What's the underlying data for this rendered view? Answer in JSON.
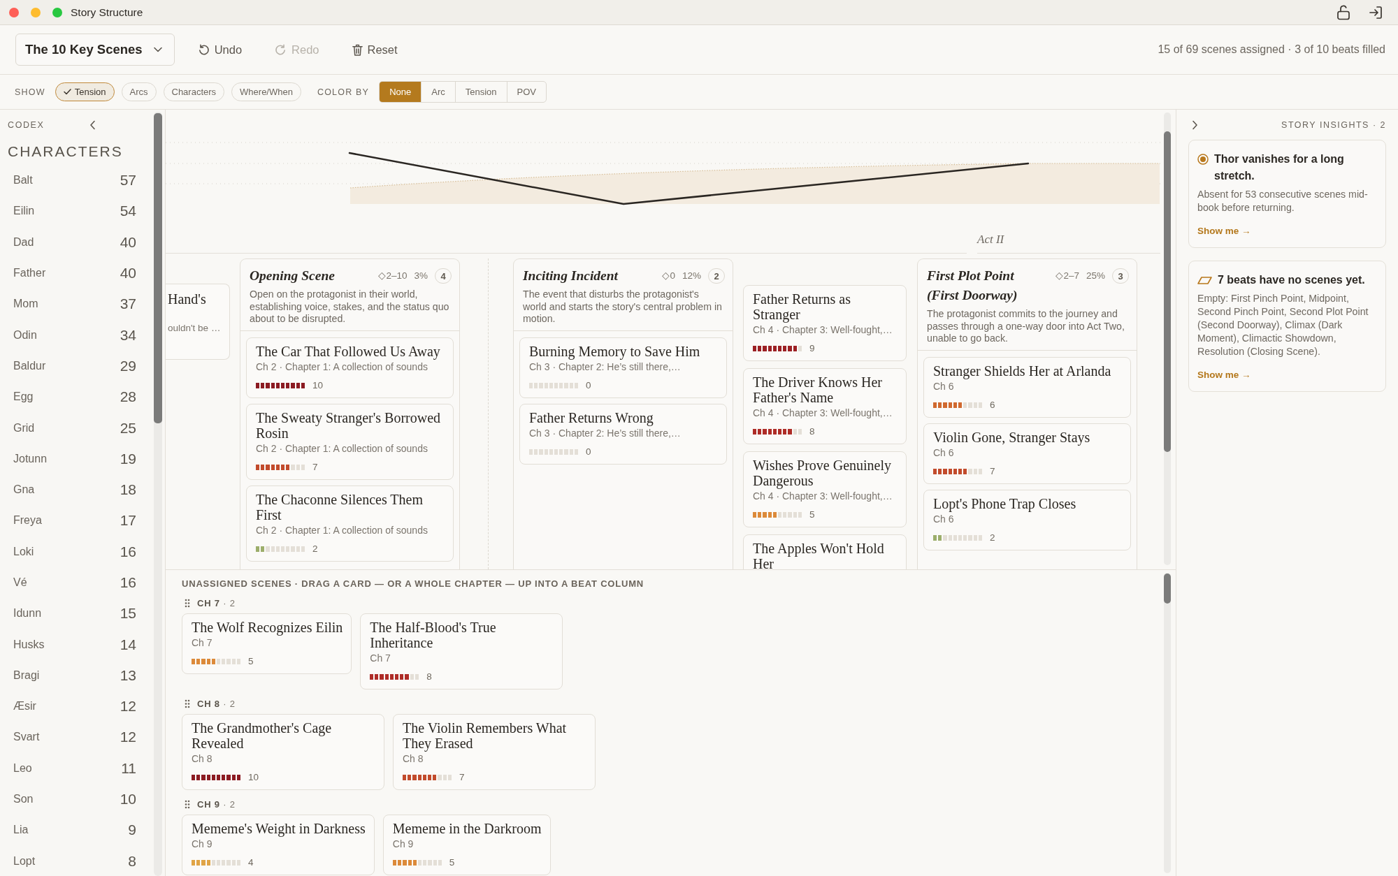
{
  "window": {
    "title": "Story Structure"
  },
  "toolbar": {
    "structure_picker": "The 10 Key Scenes",
    "actions": [
      {
        "kind": "undo",
        "label": "Undo",
        "disabled": false
      },
      {
        "kind": "redo",
        "label": "Redo",
        "disabled": true
      },
      {
        "kind": "reset",
        "label": "Reset",
        "disabled": false
      }
    ],
    "status": "15 of 69 scenes assigned · 3 of 10 beats filled"
  },
  "filter_bar": {
    "show_label": "SHOW",
    "show_toggles": [
      {
        "label": "Tension",
        "on": true
      },
      {
        "label": "Arcs",
        "on": false
      },
      {
        "label": "Characters",
        "on": false
      },
      {
        "label": "Where/When",
        "on": false
      }
    ],
    "color_by_label": "COLOR BY",
    "color_by_options": [
      {
        "label": "None",
        "selected": true
      },
      {
        "label": "Arc",
        "selected": false
      },
      {
        "label": "Tension",
        "selected": false
      },
      {
        "label": "POV",
        "selected": false
      }
    ]
  },
  "codex": {
    "title": "CODEX",
    "section": "CHARACTERS",
    "characters": [
      {
        "name": "Balt",
        "count": "57"
      },
      {
        "name": "Eilin",
        "count": "54"
      },
      {
        "name": "Dad",
        "count": "40"
      },
      {
        "name": "Father",
        "count": "40"
      },
      {
        "name": "Mom",
        "count": "37"
      },
      {
        "name": "Odin",
        "count": "34"
      },
      {
        "name": "Baldur",
        "count": "29"
      },
      {
        "name": "Egg",
        "count": "28"
      },
      {
        "name": "Grid",
        "count": "25"
      },
      {
        "name": "Jotunn",
        "count": "19"
      },
      {
        "name": "Gna",
        "count": "18"
      },
      {
        "name": "Freya",
        "count": "17"
      },
      {
        "name": "Loki",
        "count": "16"
      },
      {
        "name": "Vé",
        "count": "16"
      },
      {
        "name": "Idunn",
        "count": "15"
      },
      {
        "name": "Husks",
        "count": "14"
      },
      {
        "name": "Bragi",
        "count": "13"
      },
      {
        "name": "Æsir",
        "count": "12"
      },
      {
        "name": "Svart",
        "count": "12"
      },
      {
        "name": "Leo",
        "count": "11"
      },
      {
        "name": "Son",
        "count": "10"
      },
      {
        "name": "Lia",
        "count": "9"
      },
      {
        "name": "Lopt",
        "count": "8"
      }
    ]
  },
  "board": {
    "act_label": "Act II",
    "columns": [
      {
        "kind": "clipped",
        "scenes": [
          {
            "title": "Hand's",
            "subtitle": "ouldn't be …"
          }
        ]
      },
      {
        "kind": "beat",
        "title": "Opening Scene",
        "range": "◇2–10",
        "share": "3%",
        "count": "4",
        "description": "Open on the protagonist in their world, establishing voice, stakes, and the status quo about to be disrupted.",
        "scenes": [
          {
            "title": "The Car That Followed Us Away",
            "subtitle": "Ch 2 · Chapter 1: A collection of sounds",
            "level": 1.0,
            "reading": "10"
          },
          {
            "title": "The Sweaty Stranger's Borrowed Rosin",
            "subtitle": "Ch 2 · Chapter 1: A collection of sounds",
            "level": 0.7,
            "reading": "7"
          },
          {
            "title": "The Chaconne Silences Them First",
            "subtitle": "Ch 2 · Chapter 1: A collection of sounds",
            "level": 0.2,
            "reading": "2"
          }
        ]
      },
      {
        "kind": "divider"
      },
      {
        "kind": "beat",
        "title": "Inciting Incident",
        "range": "◇0",
        "share": "12%",
        "count": "2",
        "description": "The event that disturbs the protagonist's world and starts the story's central problem in motion.",
        "scenes": [
          {
            "title": "Burning Memory to Save Him",
            "subtitle": "Ch 3 · Chapter 2: He’s still there,…",
            "level": 0,
            "reading": "0"
          },
          {
            "title": "Father Returns Wrong",
            "subtitle": "Ch 3 · Chapter 2: He’s still there,…",
            "level": 0,
            "reading": "0"
          }
        ]
      },
      {
        "kind": "loose",
        "scenes": [
          {
            "title": "Father Returns as Stranger",
            "subtitle": "Ch 4 · Chapter 3: Well-fought,…",
            "level": 0.9,
            "reading": "9"
          },
          {
            "title": "The Driver Knows Her Father's Name",
            "subtitle": "Ch 4 · Chapter 3: Well-fought,…",
            "level": 0.8,
            "reading": "8"
          },
          {
            "title": "Wishes Prove Genuinely Dangerous",
            "subtitle": "Ch 4 · Chapter 3: Well-fought,…",
            "level": 0.5,
            "reading": "5"
          },
          {
            "title": "The Apples Won't Hold Her"
          }
        ]
      },
      {
        "kind": "beat",
        "title": "First Plot Point (First Doorway)",
        "range": "◇2–7",
        "share": "25%",
        "count": "3",
        "description": "The protagonist commits to the journey and passes through a one-way door into Act Two, unable to go back.",
        "scenes": [
          {
            "title": "Stranger Shields Her at Arlanda",
            "subtitle": "Ch 6",
            "level": 0.6,
            "reading": "6"
          },
          {
            "title": "Violin Gone, Stranger Stays",
            "subtitle": "Ch 6",
            "level": 0.7,
            "reading": "7"
          },
          {
            "title": "Lopt's Phone Trap Closes",
            "subtitle": "Ch 6",
            "level": 0.2,
            "reading": "2"
          }
        ]
      }
    ]
  },
  "unassigned": {
    "title": "UNASSIGNED SCENES · DRAG A CARD — OR A WHOLE CHAPTER — UP INTO A BEAT COLUMN",
    "chapters": [
      {
        "label": "**CH 7** · 2",
        "scenes": [
          {
            "title": "The Wolf Recognizes Eilin",
            "subtitle": "Ch 7",
            "level": 0.5,
            "reading": "5"
          },
          {
            "title": "The Half-Blood's True Inheritance",
            "subtitle": "Ch 7",
            "level": 0.8,
            "reading": "8"
          }
        ]
      },
      {
        "label": "**CH 8** · 2",
        "scenes": [
          {
            "title": "The Grandmother's Cage Revealed",
            "subtitle": "Ch 8",
            "level": 1.0,
            "reading": "10"
          },
          {
            "title": "The Violin Remembers What They Erased",
            "subtitle": "Ch 8",
            "level": 0.7,
            "reading": "7"
          }
        ]
      },
      {
        "label": "**CH 9** · 2",
        "scenes": [
          {
            "title": "Mememe's Weight in Darkness",
            "subtitle": "Ch 9",
            "level": 0.4,
            "reading": "4"
          },
          {
            "title": "Mememe in the Darkroom",
            "subtitle": "Ch 9",
            "level": 0.5,
            "reading": "5"
          }
        ]
      }
    ]
  },
  "insights": {
    "title": "STORY INSIGHTS · 2",
    "items": [
      {
        "kind": "absence",
        "title": "Thor vanishes for a long stretch.",
        "body": "Absent for 53 consecutive scenes mid-book before returning.",
        "link": "Show me →"
      },
      {
        "kind": "empty_beats",
        "title": "7 beats have no scenes yet.",
        "body": "Empty: First Pinch Point, Midpoint, Second Pinch Point, Second Plot Point (Second Doorway), Climax (Dark Moment), Climactic Showdown, Resolution (Closing Scene).",
        "link": "Show me →"
      }
    ]
  }
}
